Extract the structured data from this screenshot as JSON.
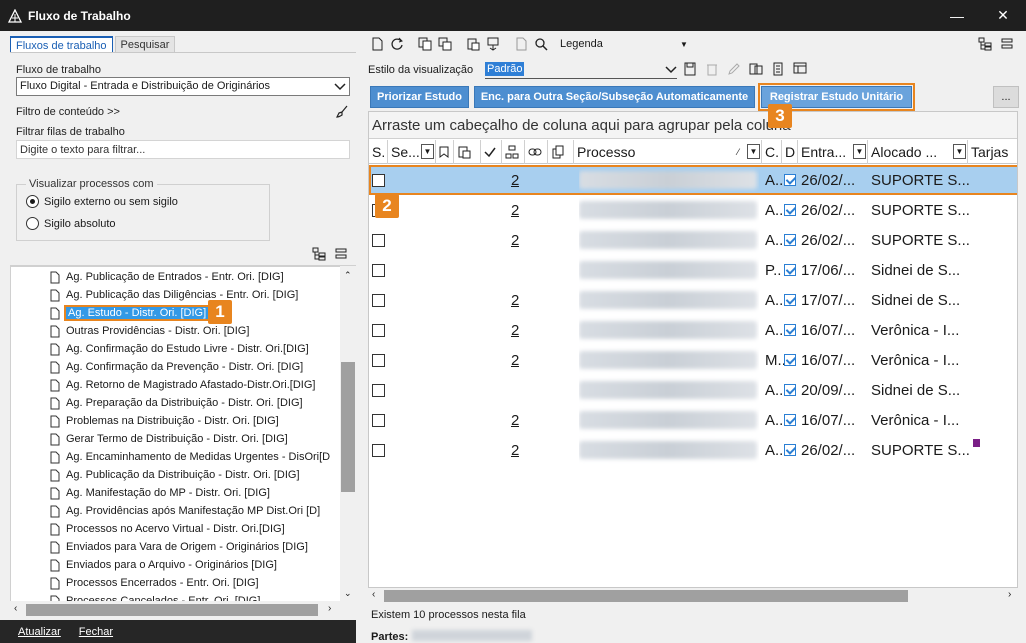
{
  "window": {
    "title": "Fluxo de Trabalho",
    "minimize": "—",
    "close": "✕"
  },
  "left": {
    "tabs": [
      "Fluxos de trabalho",
      "Pesquisar"
    ],
    "workflow_label": "Fluxo de trabalho",
    "workflow_value": "Fluxo Digital - Entrada e Distribuição de Originários",
    "content_filter": "Filtro de conteúdo >>",
    "filter_queues_label": "Filtrar filas de trabalho",
    "filter_placeholder": "Digite o texto para filtrar...",
    "view_group": "Visualizar processos com",
    "radio1": "Sigilo externo ou sem sigilo",
    "radio2": "Sigilo absoluto",
    "tree_items": [
      "Ag. Publicação de Entrados - Entr. Ori. [DIG]",
      "Ag. Publicação das Diligências - Entr. Ori. [DIG]",
      "Ag. Estudo - Distr. Ori. [DIG]",
      "Outras Providências - Distr. Ori. [DIG]",
      "Ag. Confirmação do Estudo Livre - Distr. Ori.[DIG]",
      "Ag. Confirmação da Prevenção - Distr. Ori. [DIG]",
      "Ag. Retorno de Magistrado Afastado-Distr.Ori.[DIG]",
      "Ag. Preparação da Distribuição - Distr. Ori. [DIG]",
      "Problemas na Distribuição - Distr. Ori. [DIG]",
      "Gerar Termo de Distribuição - Distr. Ori. [DIG]",
      "Ag. Encaminhamento de Medidas Urgentes - DisOri[D",
      "Ag. Publicação da Distribuição - Distr. Ori. [DIG]",
      "Ag. Manifestação do MP - Distr. Ori. [DIG]",
      "Ag. Providências após Manifestação MP Dist.Ori [D]",
      "Processos no Acervo Virtual - Distr. Ori.[DIG]",
      "Enviados para Vara de Origem - Originários [DIG]",
      "Enviados para o Arquivo - Originários [DIG]",
      "Processos Encerrados - Entr. Ori. [DIG]",
      "Processos Cancelados - Entr. Ori. [DIG]"
    ],
    "bottom_buttons": [
      "Atualizar",
      "Fechar"
    ]
  },
  "right": {
    "legend": "Legenda",
    "style_label": "Estilo da visualização",
    "style_value": "Padrão",
    "actions": [
      "Priorizar Estudo",
      "Enc. para Outra Seção/Subseção Automaticamente",
      "Registrar Estudo Unitário"
    ],
    "more": "...",
    "group_hint": "Arraste um cabeçalho de coluna aqui para agrupar pela coluna",
    "columns": [
      "S.",
      "Se...",
      "Processo",
      "C.",
      "D",
      "Entra...",
      "Alocado ...",
      "Tarjas"
    ],
    "rows": [
      {
        "count": "2",
        "c": "A..",
        "date": "26/02/...",
        "alloc": "SUPORTE S...",
        "tarja": false
      },
      {
        "count": "2",
        "c": "A..",
        "date": "26/02/...",
        "alloc": "SUPORTE S...",
        "tarja": false
      },
      {
        "count": "2",
        "c": "A..",
        "date": "26/02/...",
        "alloc": "SUPORTE S...",
        "tarja": false
      },
      {
        "count": "",
        "c": "P..",
        "date": "17/06/...",
        "alloc": "Sidnei de S...",
        "tarja": false
      },
      {
        "count": "2",
        "c": "A..",
        "date": "17/07/...",
        "alloc": "Sidnei de S...",
        "tarja": false
      },
      {
        "count": "2",
        "c": "A..",
        "date": "16/07/...",
        "alloc": "Verônica - I...",
        "tarja": false
      },
      {
        "count": "2",
        "c": "M..",
        "date": "16/07/...",
        "alloc": "Verônica - I...",
        "tarja": false
      },
      {
        "count": "",
        "c": "A..",
        "date": "20/09/...",
        "alloc": "Sidnei de S...",
        "tarja": false
      },
      {
        "count": "2",
        "c": "A..",
        "date": "16/07/...",
        "alloc": "Verônica - I...",
        "tarja": false
      },
      {
        "count": "2",
        "c": "A..",
        "date": "26/02/...",
        "alloc": "SUPORTE S...",
        "tarja": true
      }
    ],
    "status": "Existem 10 processos nesta fila",
    "partes_label": "Partes:"
  },
  "badges": [
    "1",
    "2",
    "3"
  ],
  "colors": {
    "accent": "#e8851f",
    "button": "#4d8ed0",
    "selection": "#a8cfef",
    "tarja": "#7a1f86"
  }
}
